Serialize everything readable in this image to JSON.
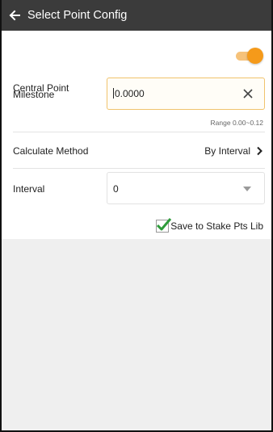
{
  "header": {
    "title": "Select Point Config",
    "back_icon": "arrow-left-icon"
  },
  "central_point": {
    "label": "Central Point",
    "enabled": true,
    "toggle_color": "#f59a1a"
  },
  "milestone": {
    "label": "Milestone",
    "value": "0.0000",
    "clear_icon": "close-icon",
    "range": "Range  0.00~0.12"
  },
  "calculate_method": {
    "label": "Calculate Method",
    "value": "By Interval",
    "chevron_icon": "chevron-right-icon"
  },
  "interval": {
    "label": "Interval",
    "value": "0",
    "dropdown_icon": "dropdown-arrow-icon"
  },
  "save_option": {
    "label": "Save to Stake Pts Lib",
    "checked": true,
    "check_color": "#2e9b3a"
  },
  "colors": {
    "appbar": "#3b3b3b",
    "accent": "#f59a1a",
    "background_empty": "#efefef"
  }
}
